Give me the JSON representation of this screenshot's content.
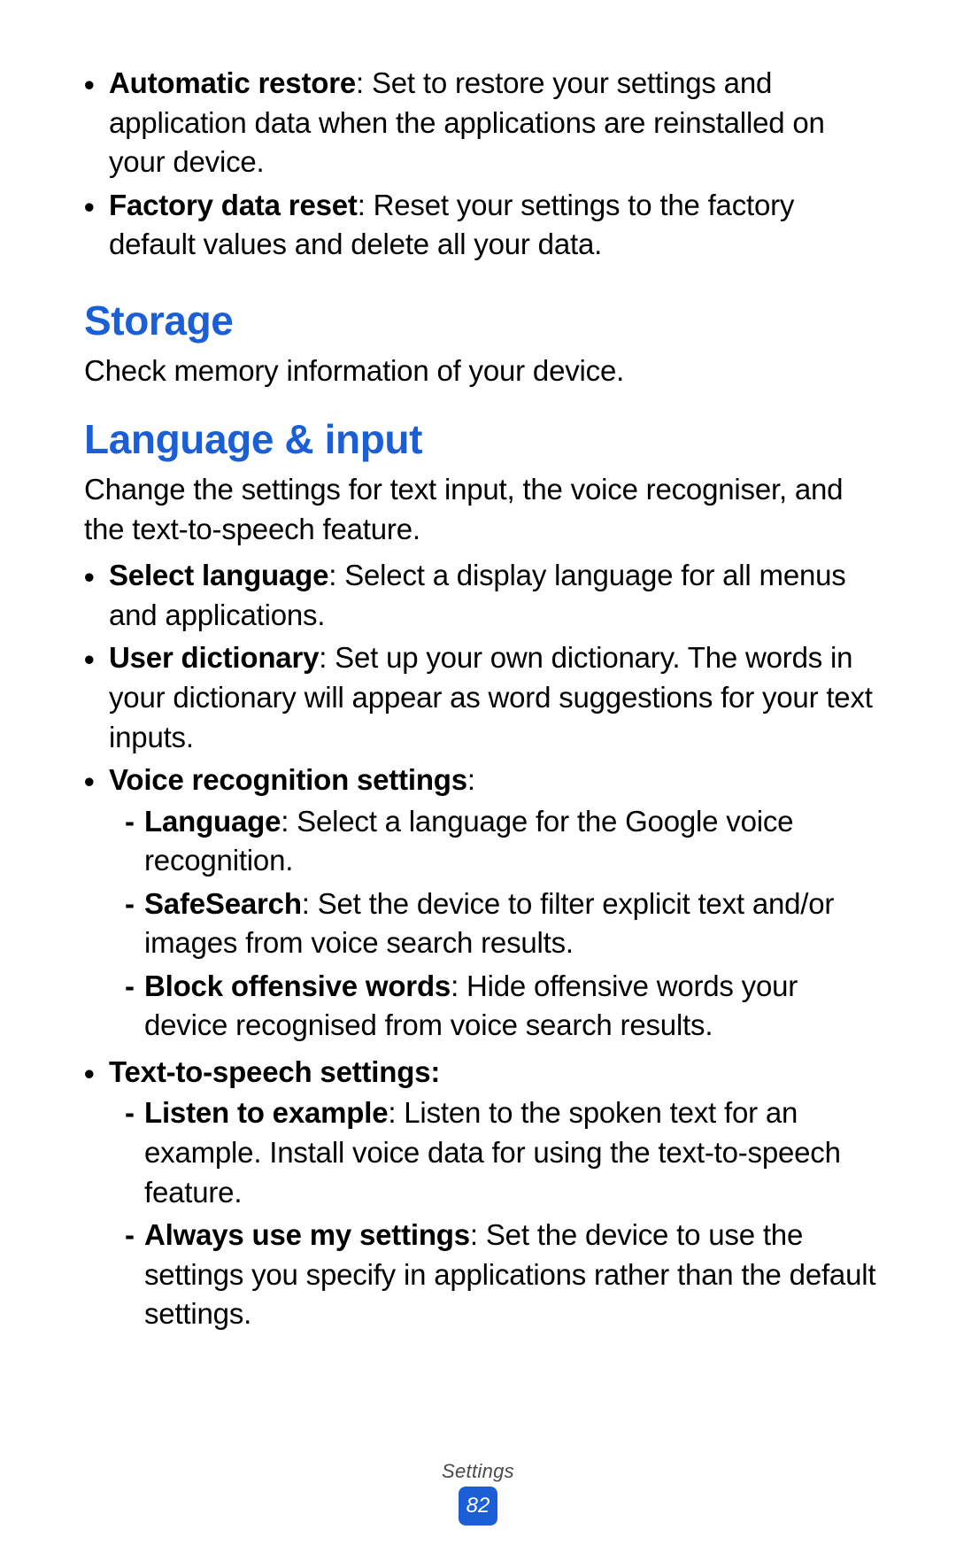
{
  "top_items": [
    {
      "term": "Automatic restore",
      "desc": ": Set to restore your settings and application data when the applications are reinstalled on your device."
    },
    {
      "term": "Factory data reset",
      "desc": ": Reset your settings to the factory default values and delete all your data."
    }
  ],
  "storage": {
    "title": "Storage",
    "desc": "Check memory information of your device."
  },
  "language": {
    "title": "Language & input",
    "desc": "Change the settings for text input, the voice recogniser, and the text-to-speech feature.",
    "items": [
      {
        "term": "Select language",
        "desc": ": Select a display language for all menus and applications."
      },
      {
        "term": "User dictionary",
        "desc": ": Set up your own dictionary. The words in your dictionary will appear as word suggestions for your text inputs."
      },
      {
        "term": "Voice recognition settings",
        "desc": ":",
        "sub": [
          {
            "term": "Language",
            "desc": ": Select a language for the Google voice recognition."
          },
          {
            "term": "SafeSearch",
            "desc": ": Set the device to filter explicit text and/or images from voice search results."
          },
          {
            "term": "Block offensive words",
            "desc": ": Hide offensive words your device recognised from voice search results."
          }
        ]
      },
      {
        "term": "Text-to-speech settings:",
        "desc": "",
        "sub": [
          {
            "term": "Listen to example",
            "desc": ": Listen to the spoken text for an example. Install voice data for using the text-to-speech feature."
          },
          {
            "term": "Always use my settings",
            "desc": ": Set the device to use the settings you specify in applications rather than the default settings."
          }
        ]
      }
    ]
  },
  "footer": {
    "section": "Settings",
    "page": "82"
  }
}
